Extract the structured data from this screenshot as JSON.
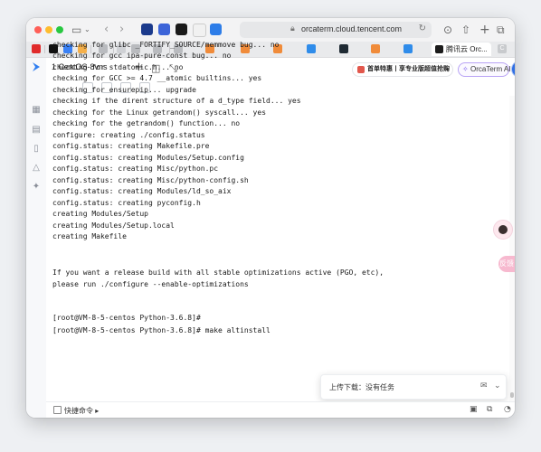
{
  "browser": {
    "url": "orcaterm.cloud.tencent.com",
    "active_tab_title": "腾讯云 Orc...",
    "pinned_tab_label": "C"
  },
  "orca": {
    "session_tab": "1  CentOS-8vns",
    "promo_label": "首单特惠丨享专业版超值抢购",
    "ai_button": "OrcaTerm AI"
  },
  "terminal": {
    "lines": [
      "checking for glibc _FORTIFY_SOURCE/memmove bug... no",
      "checking for gcc ipa-pure-const bug... no",
      "checking for stdatomic.h... no",
      "checking for GCC >= 4.7 __atomic builtins... yes",
      "checking for ensurepip... upgrade",
      "checking if the dirent structure of a d_type field... yes",
      "checking for the Linux getrandom() syscall... yes",
      "checking for the getrandom() function... no",
      "configure: creating ./config.status",
      "config.status: creating Makefile.pre",
      "config.status: creating Modules/Setup.config",
      "config.status: creating Misc/python.pc",
      "config.status: creating Misc/python-config.sh",
      "config.status: creating Modules/ld_so_aix",
      "config.status: creating pyconfig.h",
      "creating Modules/Setup",
      "creating Modules/Setup.local",
      "creating Makefile",
      "",
      "",
      "If you want a release build with all stable optimizations active (PGO, etc),",
      "please run ./configure --enable-optimizations",
      "",
      "",
      "[root@VM-8-5-centos Python-3.6.8]#",
      "[root@VM-8-5-centos Python-3.6.8]# make altinstall"
    ]
  },
  "upload_panel": {
    "label": "上传下载：没有任务"
  },
  "bottom_bar": {
    "quick_command": "快捷命令"
  },
  "floating": {
    "pink_label": "反馈"
  }
}
